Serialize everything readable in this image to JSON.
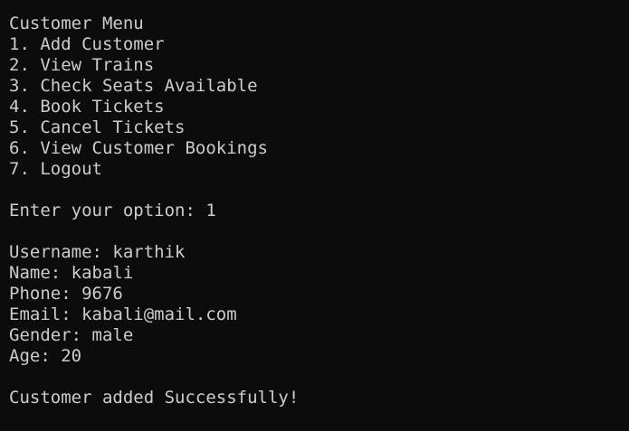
{
  "terminal": {
    "menu_title": "Customer Menu",
    "menu_items": [
      "1. Add Customer",
      "2. View Trains",
      "3. Check Seats Available",
      "4. Book Tickets",
      "5. Cancel Tickets",
      "6. View Customer Bookings",
      "7. Logout"
    ],
    "option_prompt": "Enter your option: 1",
    "fields": [
      "Username: karthik",
      "Name: kabali",
      "Phone: 9676",
      "Email: kabali@mail.com",
      "Gender: male",
      "Age: 20"
    ],
    "result_message": "Customer added Successfully!"
  },
  "colors": {
    "background": "#0c0c0c",
    "foreground": "#cccccc"
  }
}
